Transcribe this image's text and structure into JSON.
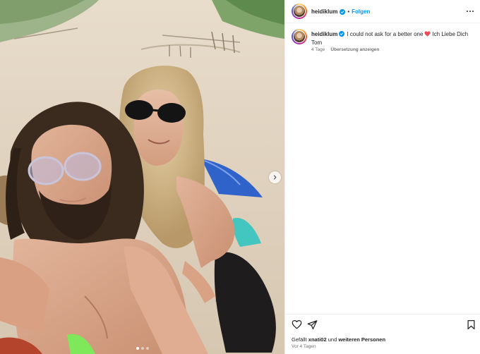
{
  "post": {
    "username": "heidiklum",
    "follow_label": "Folgen",
    "separator": "•",
    "caption_text": "I could not ask for a better one",
    "caption_text_after": "Ich Liebe Dich Tom",
    "caption_time": "4 Tage",
    "translate_label": "Übersetzung anzeigen"
  },
  "likes": {
    "prefix": "Gefällt",
    "user": "xnati02",
    "connector": "und",
    "others": "weiteren Personen"
  },
  "timestamp": "Vor 4 Tagen",
  "carousel": {
    "slides": 3,
    "active": 1
  },
  "colors": {
    "accent_blue": "#0095f6",
    "heart_red": "#ed4956",
    "text": "#262626",
    "muted": "#737373"
  },
  "icons": {
    "more": "more-horizontal-icon",
    "verified": "verified-badge-icon",
    "like": "heart-outline-icon",
    "share": "paper-plane-icon",
    "save": "bookmark-icon",
    "next": "chevron-right-icon"
  }
}
